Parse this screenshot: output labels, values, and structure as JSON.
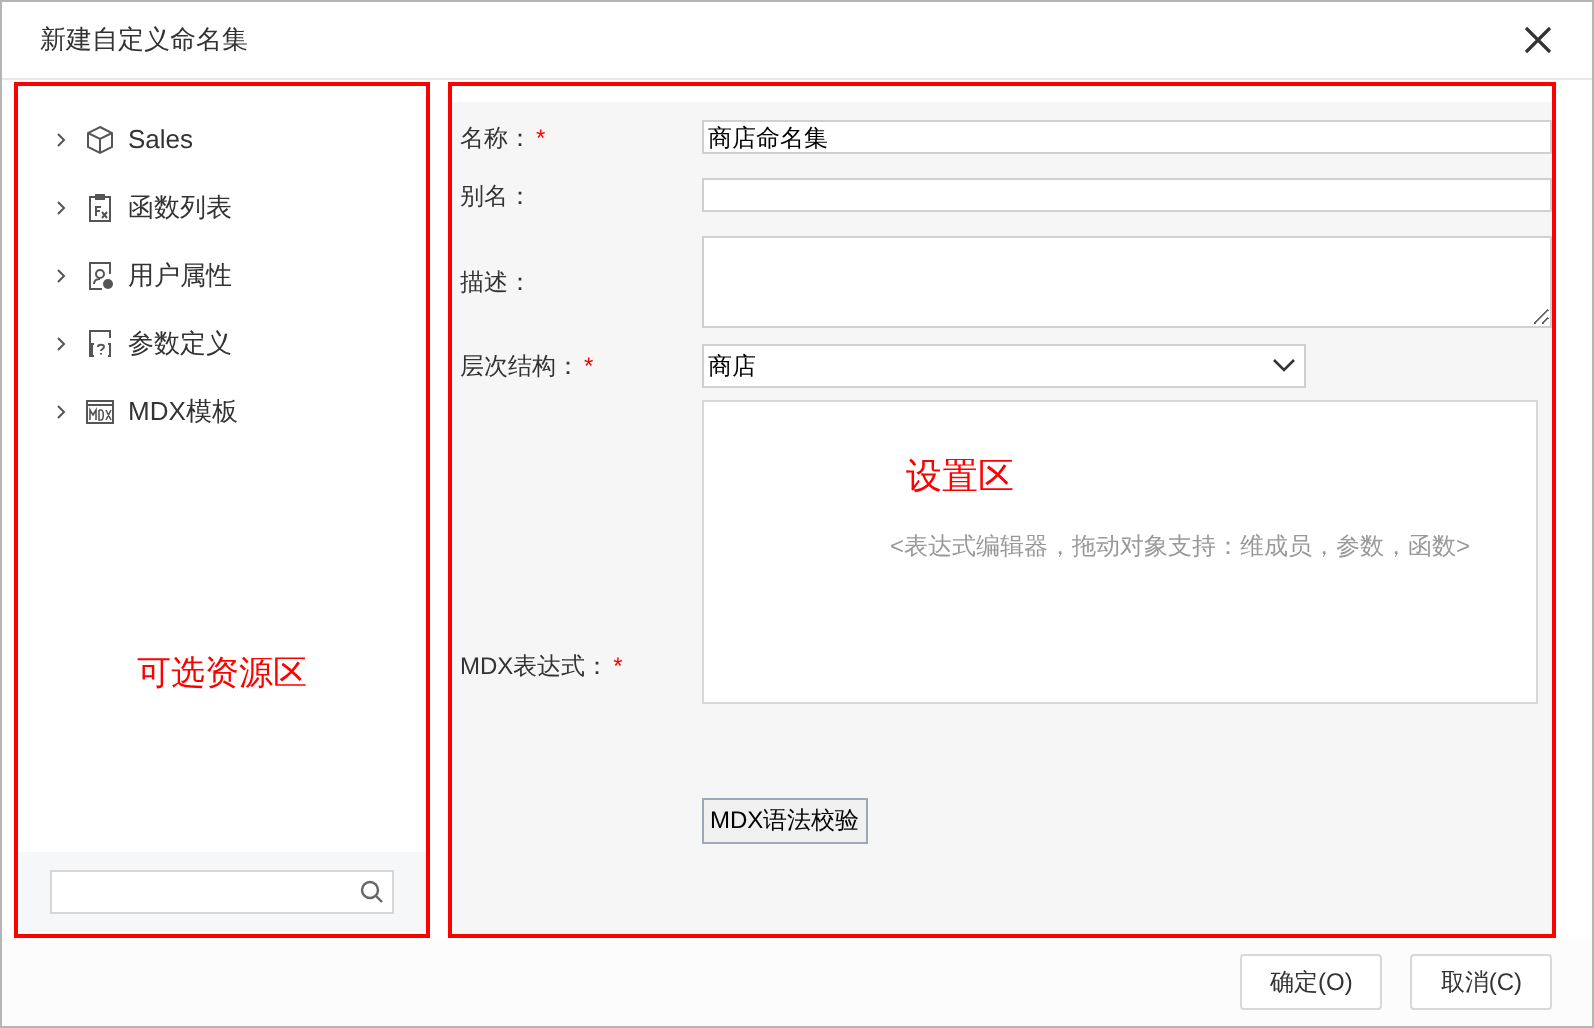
{
  "window": {
    "title": "新建自定义命名集"
  },
  "resource_tree": {
    "items": [
      {
        "label": "Sales",
        "kind": "cube",
        "expanded": false
      },
      {
        "label": "函数列表",
        "kind": "function",
        "expanded": false
      },
      {
        "label": "用户属性",
        "kind": "user",
        "expanded": false
      },
      {
        "label": "参数定义",
        "kind": "parameter",
        "expanded": false
      },
      {
        "label": "MDX模板",
        "kind": "template",
        "expanded": false
      }
    ]
  },
  "annotations": [
    {
      "text": "可选资源区"
    },
    {
      "text": "设置区"
    }
  ],
  "form": {
    "fields": [
      {
        "kind": "text",
        "label": "名称：",
        "required_mark": "*",
        "value": "商店命名集"
      },
      {
        "kind": "text",
        "label": "别名："
      },
      {
        "kind": "textarea",
        "label": "描述："
      },
      {
        "kind": "select",
        "label": "层次结构：",
        "required_mark": "*",
        "value": "商店"
      },
      {
        "kind": "editor",
        "label": "MDX表达式：",
        "required_mark": "*",
        "placeholder": "<表达式编辑器，拖动对象支持：维成员，参数，函数>"
      }
    ],
    "validate_button": "MDX语法校验"
  },
  "buttons": [
    {
      "label": "确定(O)"
    },
    {
      "label": "取消(C)"
    }
  ]
}
